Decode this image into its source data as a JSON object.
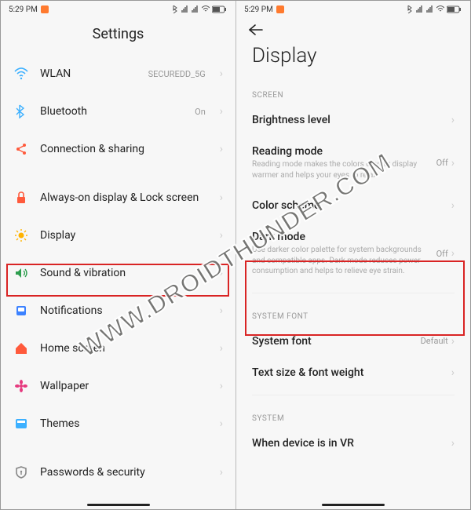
{
  "status": {
    "time": "5:29 PM",
    "battery": "61"
  },
  "left": {
    "title": "Settings",
    "items": [
      {
        "name": "wlan",
        "label": "WLAN",
        "value": "SECUREDD_5G",
        "icon": "wifi",
        "color": "#3cb0ff"
      },
      {
        "name": "bluetooth",
        "label": "Bluetooth",
        "value": "On",
        "icon": "bt",
        "color": "#3cb0ff"
      },
      {
        "name": "connshare",
        "label": "Connection & sharing",
        "value": "",
        "icon": "share",
        "color": "#ff5a3c"
      },
      {
        "name": "aod",
        "label": "Always-on display & Lock screen",
        "value": "",
        "icon": "lock",
        "color": "#ff5a3c"
      },
      {
        "name": "display",
        "label": "Display",
        "value": "",
        "icon": "sun",
        "color": "#ffb300"
      },
      {
        "name": "sound",
        "label": "Sound & vibration",
        "value": "",
        "icon": "vol",
        "color": "#2e9e4f"
      },
      {
        "name": "notif",
        "label": "Notifications",
        "value": "",
        "icon": "bell",
        "color": "#3c82ff"
      },
      {
        "name": "home",
        "label": "Home screen",
        "value": "",
        "icon": "home",
        "color": "#ff5a3c"
      },
      {
        "name": "wallpaper",
        "label": "Wallpaper",
        "value": "",
        "icon": "flower",
        "color": "#e6397e"
      },
      {
        "name": "themes",
        "label": "Themes",
        "value": "",
        "icon": "theme",
        "color": "#3cb0ff"
      },
      {
        "name": "passwords",
        "label": "Passwords & security",
        "value": "",
        "icon": "shield",
        "color": "#888888"
      }
    ]
  },
  "right": {
    "title": "Display",
    "sections": {
      "screen": {
        "label": "SCREEN",
        "items": [
          {
            "name": "brightness",
            "title": "Brightness level",
            "desc": "",
            "value": ""
          },
          {
            "name": "reading",
            "title": "Reading mode",
            "desc": "Reading mode makes the colors of your display warmer and helps your eyes to relax",
            "value": "Off"
          },
          {
            "name": "colorscheme",
            "title": "Color scheme",
            "desc": "",
            "value": ""
          },
          {
            "name": "darkmode",
            "title": "Dark mode",
            "desc": "Use darker color palette for system backgrounds and compatible apps. Dark mode reduces power consumption and helps to relieve eye strain.",
            "value": "Off"
          }
        ]
      },
      "font": {
        "label": "SYSTEM FONT",
        "items": [
          {
            "name": "sysfont",
            "title": "System font",
            "desc": "",
            "value": "Default"
          },
          {
            "name": "textsize",
            "title": "Text size & font weight",
            "desc": "",
            "value": ""
          }
        ]
      },
      "system": {
        "label": "SYSTEM",
        "items": [
          {
            "name": "vr",
            "title": "When device is in VR",
            "desc": "",
            "value": ""
          }
        ]
      }
    }
  },
  "watermark": "WWW.DROIDTHUNDER.COM"
}
